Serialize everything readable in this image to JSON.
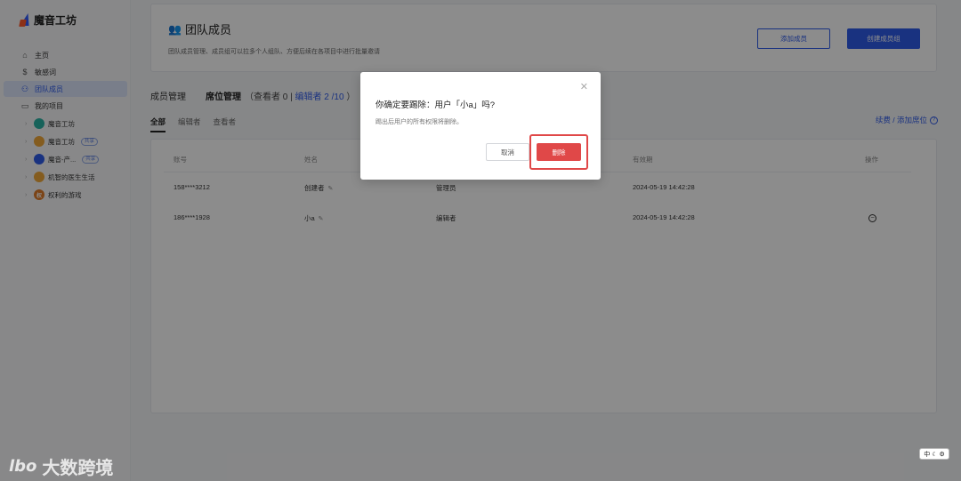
{
  "app": {
    "logo_text": "魔音工坊"
  },
  "sidebar": {
    "nav": [
      {
        "label": "主页",
        "icon": "home-icon"
      },
      {
        "label": "敏感词",
        "icon": "dollar-icon"
      },
      {
        "label": "团队成员",
        "icon": "team-icon"
      },
      {
        "label": "我的项目",
        "icon": "folder-icon"
      }
    ],
    "projects": [
      {
        "label": "魔音工坊",
        "avatar": "",
        "color": "#2bb3a5",
        "tag": ""
      },
      {
        "label": "魔音工坊",
        "avatar": "",
        "color": "#f0a83a",
        "tag": "共享"
      },
      {
        "label": "魔音-产...",
        "avatar": "",
        "color": "#2f5bea",
        "tag": "共享"
      },
      {
        "label": "机智的医生生活",
        "avatar": "",
        "color": "#f0a83a",
        "tag": ""
      },
      {
        "label": "权利的游戏",
        "avatar": "权",
        "color": "#e07d2a",
        "tag": ""
      }
    ]
  },
  "header": {
    "title": "团队成员",
    "description": "团队成员管理、成员组可以拉多个人组队、方便后续在各项目中进行批量邀请",
    "add_member": "添加成员",
    "create_group": "创建成员组"
  },
  "tabs": {
    "members": "成员管理",
    "seats": "席位管理",
    "viewer_text": "（查看者 0 |",
    "editor_text": "编辑者 2 /10",
    "close_paren": "）"
  },
  "subtabs": [
    "全部",
    "编辑者",
    "查看者"
  ],
  "renew": "续费 / 添加席位",
  "table": {
    "headers": {
      "account": "账号",
      "name": "姓名",
      "role": "",
      "expiry": "有效期",
      "action": "操作"
    },
    "rows": [
      {
        "account": "158****3212",
        "name": "创建者",
        "role": "管理员",
        "expiry": "2024-05-19 14:42:28"
      },
      {
        "account": "186****1928",
        "name": "小a",
        "role": "编辑者",
        "expiry": "2024-05-19 14:42:28"
      }
    ]
  },
  "modal": {
    "title": "你确定要踢除：用户「小a」吗?",
    "description": "踢出后用户的所有权限将删除。",
    "cancel": "取消",
    "confirm": "删除",
    "accent": "#e04848"
  },
  "watermark": {
    "logo": "lbo",
    "text": "大数跨境"
  },
  "ime": {
    "label": "中"
  }
}
